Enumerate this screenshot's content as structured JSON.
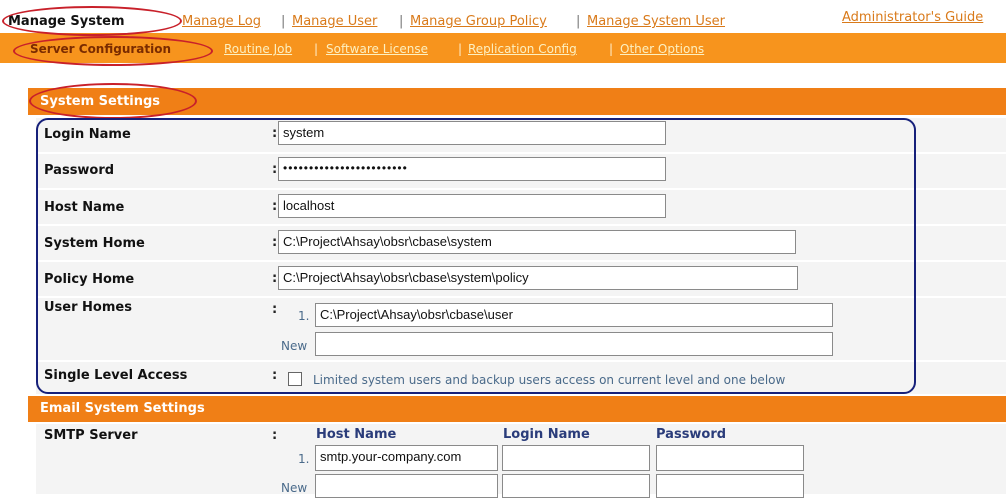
{
  "top_nav": {
    "items": [
      {
        "label": "Manage System"
      },
      {
        "label": "Manage Log"
      },
      {
        "label": "Manage User"
      },
      {
        "label": "Manage Group Policy"
      },
      {
        "label": "Manage System User"
      }
    ],
    "separator": "|",
    "guide_link": "Administrator's Guide"
  },
  "sub_nav": {
    "items": [
      {
        "label": "Server Configuration"
      },
      {
        "label": "Routine Job"
      },
      {
        "label": "Software License"
      },
      {
        "label": "Replication Config"
      },
      {
        "label": "Other Options"
      }
    ],
    "separator": "|"
  },
  "system_settings": {
    "title": "System Settings",
    "colon": ":",
    "login_name": {
      "label": "Login Name",
      "value": "system"
    },
    "password": {
      "label": "Password",
      "value": "••••••••••••••••••••••••"
    },
    "host_name": {
      "label": "Host Name",
      "value": "localhost"
    },
    "system_home": {
      "label": "System Home",
      "value": "C:\\Project\\Ahsay\\obsr\\cbase\\system"
    },
    "policy_home": {
      "label": "Policy Home",
      "value": "C:\\Project\\Ahsay\\obsr\\cbase\\system\\policy"
    },
    "user_homes": {
      "label": "User Homes",
      "index_1": "1.",
      "value_1": "C:\\Project\\Ahsay\\obsr\\cbase\\user",
      "new_label": "New",
      "new_value": ""
    },
    "single_level_access": {
      "label": "Single Level Access",
      "checked": false,
      "description": "Limited system users and backup users access on current level and one below"
    }
  },
  "email_settings": {
    "title": "Email System Settings",
    "smtp_label": "SMTP Server",
    "colon": ":",
    "columns": [
      "Host Name",
      "Login Name",
      "Password"
    ],
    "index_1": "1.",
    "row1_host": "smtp.your-company.com",
    "row1_login": "",
    "row1_password": "",
    "new_label": "New"
  },
  "colors": {
    "subnav_bg": "#f7941d",
    "section_bg": "#f07f16",
    "highlight_oval": "#c8202a",
    "highlight_box": "#16207a"
  }
}
